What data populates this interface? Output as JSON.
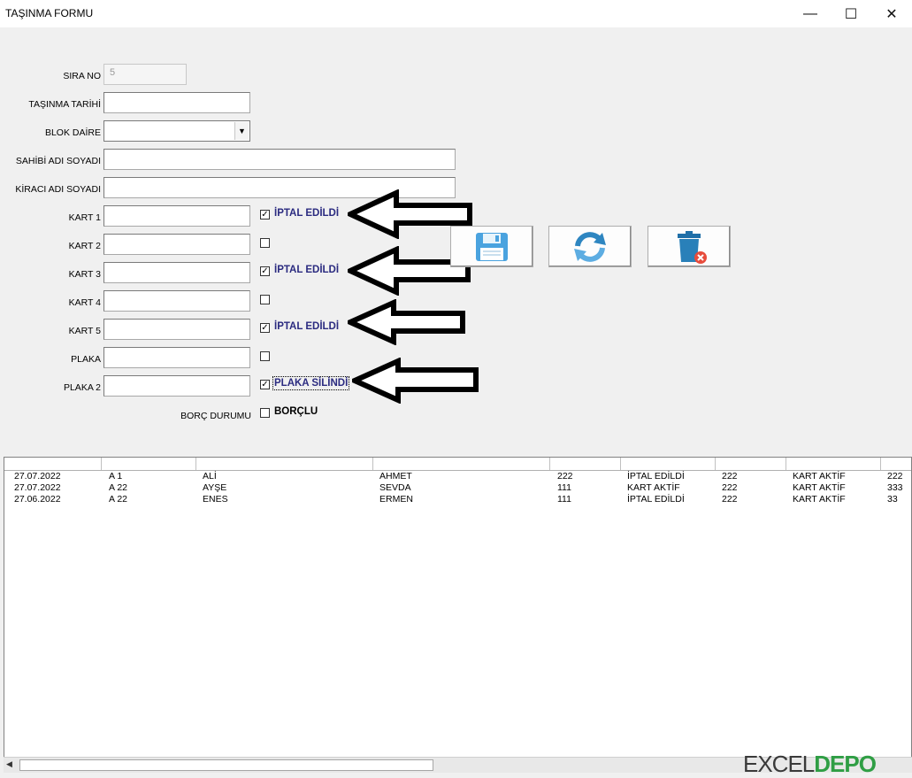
{
  "window": {
    "title": "TAŞINMA FORMU",
    "minimize": "—",
    "maximize": "☐",
    "close": "✕"
  },
  "form": {
    "sira_no": {
      "label": "SIRA NO",
      "value": "5"
    },
    "tasinma_tarihi": {
      "label": "TAŞINMA TARİHİ",
      "value": ""
    },
    "blok_daire": {
      "label": "BLOK DAİRE",
      "value": ""
    },
    "sahibi": {
      "label": "SAHİBİ ADI SOYADI",
      "value": ""
    },
    "kiraci": {
      "label": "KİRACI ADI SOYADI",
      "value": ""
    },
    "kart1": {
      "label": "KART 1",
      "value": "",
      "checked": true,
      "check_label": "İPTAL EDİLDİ"
    },
    "kart2": {
      "label": "KART 2",
      "value": "",
      "checked": false,
      "check_label": ""
    },
    "kart3": {
      "label": "KART 3",
      "value": "",
      "checked": true,
      "check_label": "İPTAL EDİLDİ"
    },
    "kart4": {
      "label": "KART 4",
      "value": "",
      "checked": false,
      "check_label": ""
    },
    "kart5": {
      "label": "KART 5",
      "value": "",
      "checked": true,
      "check_label": "İPTAL EDİLDİ"
    },
    "plaka": {
      "label": "PLAKA",
      "value": "",
      "checked": false,
      "check_label": ""
    },
    "plaka2": {
      "label": "PLAKA 2",
      "value": "",
      "checked": true,
      "check_label": "PLAKA SİLİNDİ"
    },
    "borc": {
      "label": "BORÇ DURUMU",
      "checked": false,
      "check_label": "BORÇLU"
    }
  },
  "buttons": [
    {
      "icon": "save-icon"
    },
    {
      "icon": "refresh-icon"
    },
    {
      "icon": "delete-icon"
    }
  ],
  "colors": {
    "checkbox_label": "#2b2b80",
    "save_icon": "#4aa3df",
    "refresh_icon": "#2e86c1",
    "delete_icon": "#2980b9",
    "delete_badge": "#e74c3c",
    "arrow": "#000000"
  },
  "list": {
    "rows": [
      [
        "27.07.2022",
        "A 1",
        "ALİ",
        "AHMET",
        "222",
        "İPTAL EDİLDİ",
        "222",
        "KART AKTİF",
        "222"
      ],
      [
        "27.07.2022",
        "A 22",
        "AYŞE",
        "SEVDA",
        "111",
        "KART AKTİF",
        "222",
        "KART AKTİF",
        "333"
      ],
      [
        "27.06.2022",
        "A 22",
        "ENES",
        "ERMEN",
        "111",
        "İPTAL EDİLDİ",
        "222",
        "KART AKTİF",
        "33"
      ]
    ]
  },
  "scrollbar": {
    "left_arrow": "◀"
  },
  "watermark": {
    "part1": "EXCEL",
    "part2": "DEPO"
  }
}
